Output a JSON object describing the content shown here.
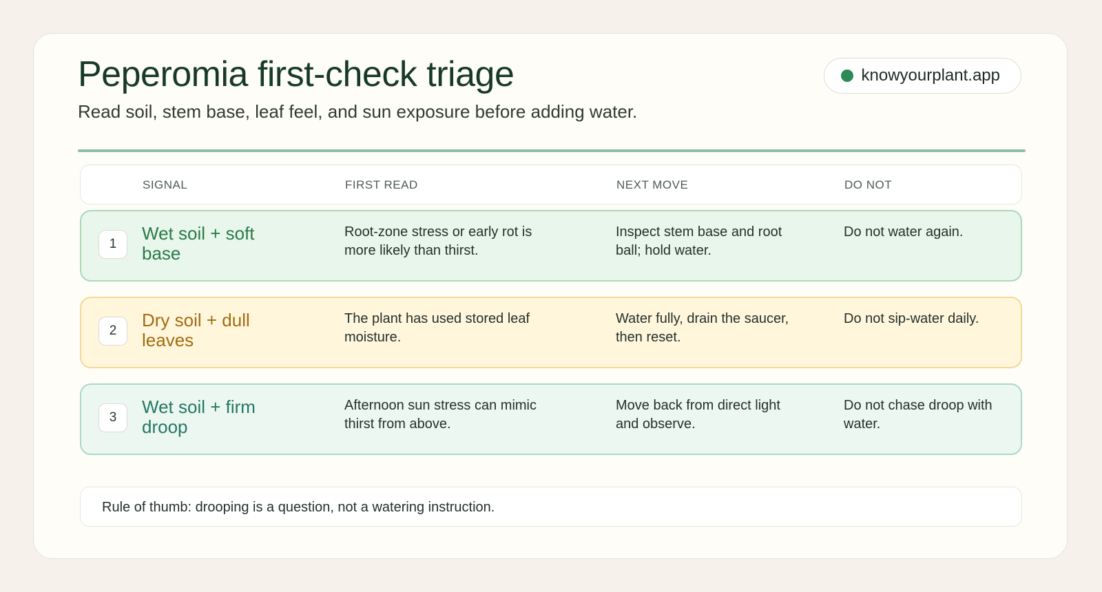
{
  "header": {
    "title": "Peperomia first-check triage",
    "subtitle": "Read soil, stem base, leaf feel, and sun exposure before adding water."
  },
  "brand": {
    "label": "knowyourplant.app",
    "dot_color": "#2e8a55"
  },
  "table": {
    "columns": [
      "SIGNAL",
      "FIRST READ",
      "NEXT MOVE",
      "DO NOT"
    ],
    "rows": [
      {
        "number": "1",
        "signal": "Wet soil + soft base",
        "first_read": "Root-zone stress or early rot is more likely than thirst.",
        "next_move": "Inspect stem base and root ball; hold water.",
        "do_not": "Do not water again.",
        "accent": "#2a7a47"
      },
      {
        "number": "2",
        "signal": "Dry soil + dull leaves",
        "first_read": "The plant has used stored leaf moisture.",
        "next_move": "Water fully, drain the saucer, then reset.",
        "do_not": "Do not sip-water daily.",
        "accent": "#a26c10"
      },
      {
        "number": "3",
        "signal": "Wet soil + firm droop",
        "first_read": "Afternoon sun stress can mimic thirst from above.",
        "next_move": "Move back from direct light and observe.",
        "do_not": "Do not chase droop with water.",
        "accent": "#247863"
      }
    ]
  },
  "footer": {
    "note": "Rule of thumb: drooping is a question, not a watering instruction."
  }
}
